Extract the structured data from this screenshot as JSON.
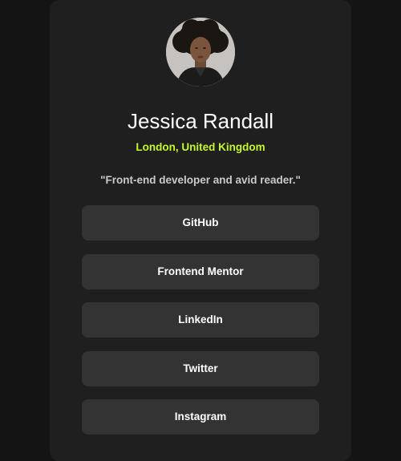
{
  "profile": {
    "name": "Jessica Randall",
    "location": "London, United Kingdom",
    "bio": "\"Front-end developer and avid reader.\"",
    "avatar_icon": "profile-photo"
  },
  "links": [
    {
      "label": "GitHub"
    },
    {
      "label": "Frontend Mentor"
    },
    {
      "label": "LinkedIn"
    },
    {
      "label": "Twitter"
    },
    {
      "label": "Instagram"
    }
  ],
  "colors": {
    "page_background": "#141414",
    "card_background": "#1f1f1f",
    "button_background": "#333333",
    "accent": "#c4f82a",
    "text": "#ffffff"
  }
}
